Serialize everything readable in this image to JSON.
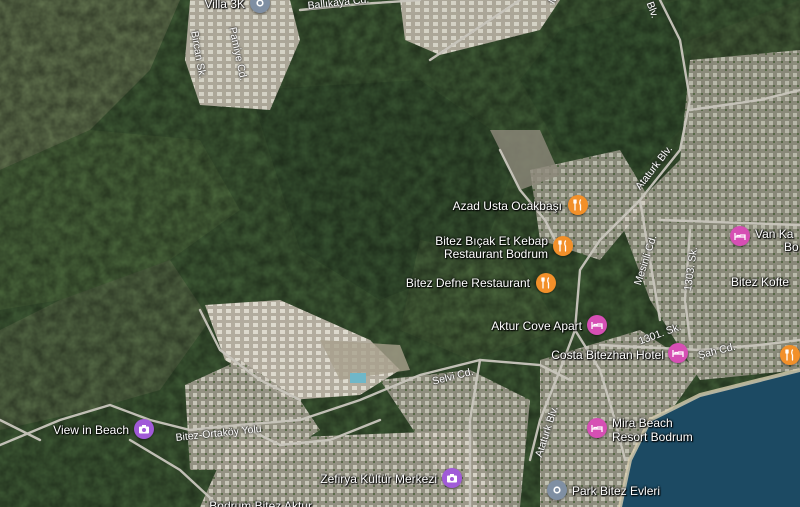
{
  "colors": {
    "restaurant": "#f2902a",
    "lodging": "#d64fb4",
    "attraction": "#a15ad8",
    "place": "#7f8fa3",
    "sea": "#1c4a63",
    "forest": "#3e5a35"
  },
  "places": {
    "villa": "Villa 3K",
    "azad": "Azad Usta Ocakbaşı",
    "bitez_bicak_1": "Bitez Bıçak Et Kebap",
    "bitez_bicak_2": "Restaurant Bodrum",
    "bitez_defne": "Bitez Defne Restaurant",
    "aktur": "Aktur Cove Apart",
    "costa": "Costa Bitezhan Hotel",
    "mira_1": "Mira Beach",
    "mira_2": "Resort Bodrum",
    "view_in_beach": "View in Beach",
    "zefirya": "Zefirya Kültür Merkezi",
    "park_bitez": "Park Bitez Evleri",
    "van_1": "Van Ka",
    "van_2": "Bo",
    "bitez_kofte": "Bitez Kofte",
    "bodrum_bitez": "Bodrum Bitez Aktur"
  },
  "roads": {
    "ballikaya": "Ballıkaya Cd.",
    "pamuye": "Pamiye Cd.",
    "bircan": "Bircan Sk.",
    "ataturk_1": "Ataturk Blv.",
    "ataturk_2": "Ataturk Blv.",
    "ataturk_top": "Blv.",
    "mesinli": "Mesinli Cd.",
    "sk_1303": "1303. Sk.",
    "sk_1301": "1301. Sk.",
    "sah": "Şah Cd.",
    "selvi": "Selvi Cd.",
    "bitez_ortakoy": "Bitez-Ortaköy Yolu",
    "m_top": "M"
  },
  "icons": {
    "restaurant": "fork-knife-icon",
    "lodging": "bed-icon",
    "attraction": "camera-icon",
    "place": "location-pin-icon"
  }
}
